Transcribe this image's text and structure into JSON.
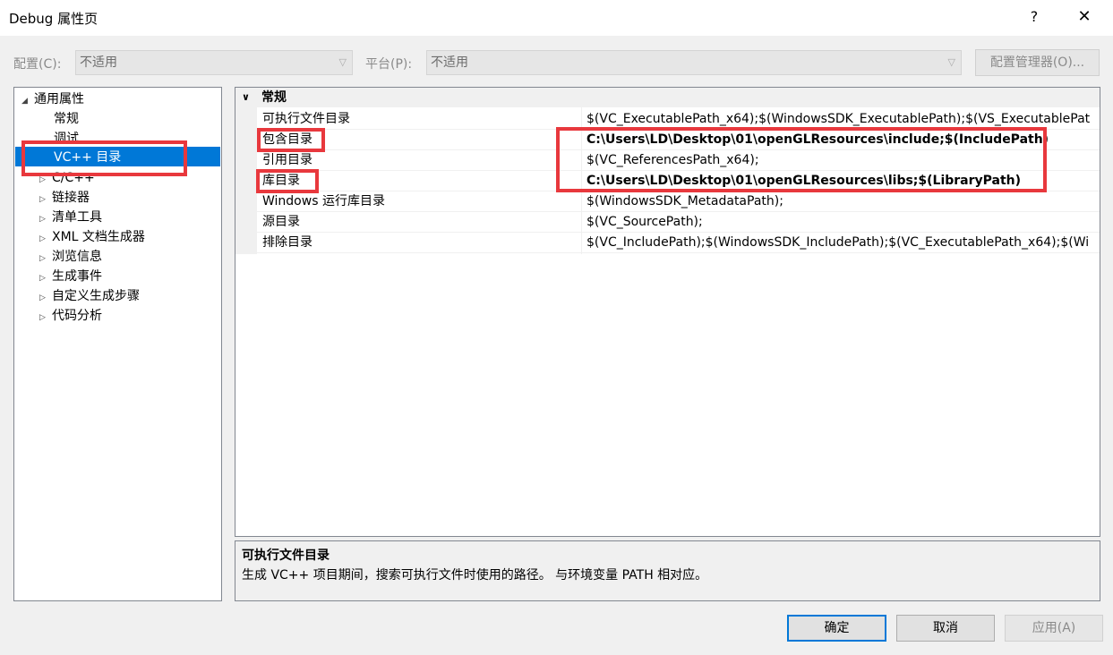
{
  "window": {
    "title": "Debug 属性页",
    "help": "?",
    "close": "✕"
  },
  "config_row": {
    "config_label": "配置(C):",
    "config_value": "不适用",
    "platform_label": "平台(P):",
    "platform_value": "不适用",
    "manager_button": "配置管理器(O)..."
  },
  "tree": {
    "root": "通用属性",
    "children": [
      "常规",
      "调试",
      "VC++ 目录",
      "C/C++",
      "链接器",
      "清单工具",
      "XML 文档生成器",
      "浏览信息",
      "生成事件",
      "自定义生成步骤",
      "代码分析"
    ],
    "selected": "VC++ 目录"
  },
  "grid": {
    "category": "常规",
    "rows": [
      {
        "name": "可执行文件目录",
        "value": "$(VC_ExecutablePath_x64);$(WindowsSDK_ExecutablePath);$(VS_ExecutablePat"
      },
      {
        "name": "包含目录",
        "value": "C:\\Users\\LD\\Desktop\\01\\openGLResources\\include;$(IncludePath)"
      },
      {
        "name": "引用目录",
        "value": "$(VC_ReferencesPath_x64);"
      },
      {
        "name": "库目录",
        "value": "C:\\Users\\LD\\Desktop\\01\\openGLResources\\libs;$(LibraryPath)"
      },
      {
        "name": "Windows 运行库目录",
        "value": "$(WindowsSDK_MetadataPath);"
      },
      {
        "name": "源目录",
        "value": "$(VC_SourcePath);"
      },
      {
        "name": "排除目录",
        "value": "$(VC_IncludePath);$(WindowsSDK_IncludePath);$(VC_ExecutablePath_x64);$(Wi"
      }
    ]
  },
  "description": {
    "title": "可执行文件目录",
    "text": "生成 VC++ 项目期间，搜索可执行文件时使用的路径。 与环境变量 PATH 相对应。"
  },
  "buttons": {
    "ok": "确定",
    "cancel": "取消",
    "apply": "应用(A)"
  },
  "colors": {
    "selection": "#0078d7",
    "annotation": "#e8383d"
  }
}
